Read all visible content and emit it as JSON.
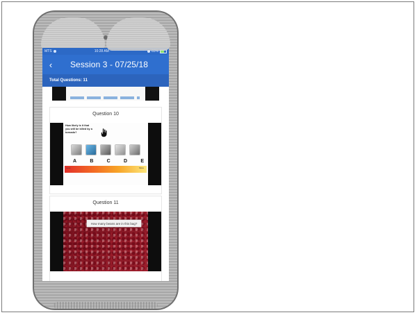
{
  "status_bar": {
    "carrier": "MTS",
    "time": "10:28 AM",
    "battery": "83%"
  },
  "header": {
    "back_icon": "chevron-left-icon",
    "title": "Session 3 - 07/25/18"
  },
  "subheader": {
    "text": "Total Questions: 11"
  },
  "questions": [
    {
      "title": "Question 10",
      "slide": {
        "question": "How likely is it that you will be killed by a tornado?",
        "letters": [
          "A",
          "B",
          "C",
          "D",
          "E"
        ],
        "scale_left": "Less",
        "scale_right": "More"
      }
    },
    {
      "title": "Question 11",
      "slide": {
        "question": "How many beans are in this bag?"
      }
    }
  ]
}
